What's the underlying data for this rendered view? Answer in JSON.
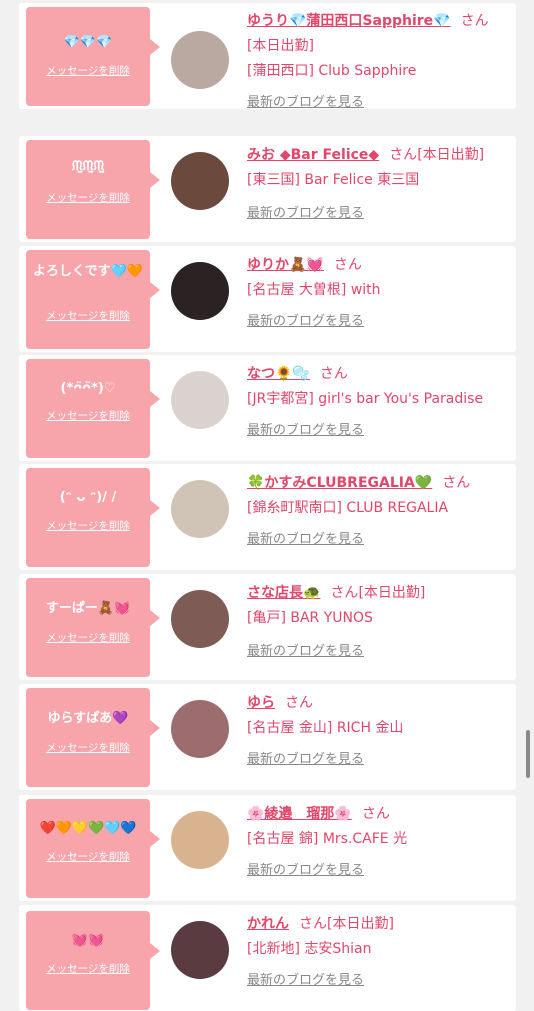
{
  "delete_label": "メッセージを削除",
  "blog_label": "最新のブログを見る",
  "san_label": "さん",
  "cards": [
    {
      "message": "💎💎💎",
      "name": "ゆうり💎蒲田西口Sapphire💎",
      "after": "",
      "shop1": "[本日出勤]",
      "shop2": "[蒲田西口] Club Sapphire"
    },
    {
      "message": "ᙏ̤̫ᙏ̤̫ᙏ̤̫",
      "name": "みお ◆Bar Felice◆",
      "after": "[本日出勤]",
      "shop1": "[東三国] Bar Felice 東三国",
      "shop2": ""
    },
    {
      "message": "よろしくです🩵🧡",
      "name": "ゆりか🧸💓",
      "after": "",
      "shop1": "[名古屋 大曽根] with",
      "shop2": ""
    },
    {
      "message": "(*ᴖ̈ᴖ̈*)♡",
      "name": "なつ🌻🫧",
      "after": "",
      "shop1": "[JR宇都宮] girl's bar You's Paradise",
      "shop2": ""
    },
    {
      "message": "(ᵔ ᴗ ᵔ)/ /",
      "name": "🍀かすみCLUBREGALIA💚",
      "after": "",
      "shop1": "[錦糸町駅南口] CLUB REGALIA",
      "shop2": ""
    },
    {
      "message": "すーぱー🧸💓",
      "name": "さな店長🐢",
      "after": "[本日出勤]",
      "shop1": "[亀戸] BAR YUNOS",
      "shop2": ""
    },
    {
      "message": "ゆらすぱあ💜",
      "name": "ゆら",
      "after": "",
      "shop1": "[名古屋 金山] RICH 金山",
      "shop2": ""
    },
    {
      "message": "❤️🧡💛💚🩵💙",
      "name": "🌸綾邉　瑠那🌸",
      "after": "",
      "shop1": "[名古屋 錦] Mrs.CAFE 光",
      "shop2": ""
    },
    {
      "message": "💓💓",
      "name": "かれん",
      "after": "[本日出勤]",
      "shop1": "[北新地] 志安Shian",
      "shop2": ""
    }
  ],
  "colors": {
    "accent": "#e0476a",
    "bubble": "#f7a4ab",
    "background": "#f1f1f1"
  },
  "avatar_colors": [
    "#b9a9a0",
    "#6b4a3d",
    "#2b2224",
    "#d9d2cf",
    "#cfc4b6",
    "#7e5c55",
    "#9d6c6e",
    "#d9b38f",
    "#5a3b3f"
  ]
}
